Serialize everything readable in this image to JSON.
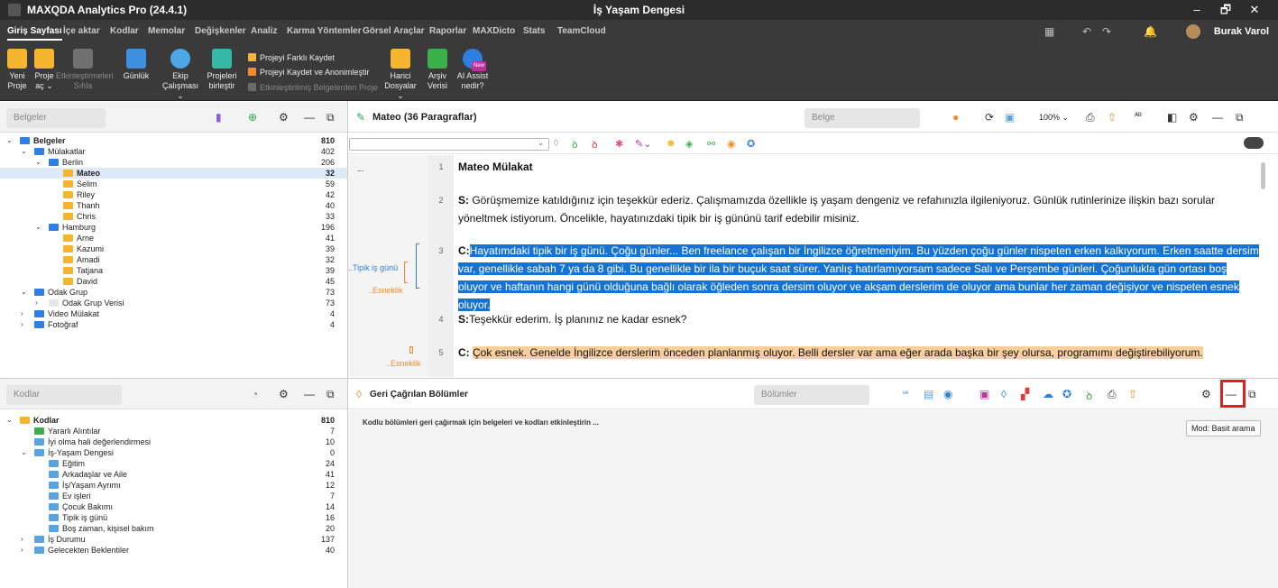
{
  "app": {
    "title": "MAXQDA Analytics Pro (24.4.1)",
    "document_title": "İş Yaşam Dengesi",
    "user": "Burak Varol"
  },
  "window_controls": {
    "minimize": "–",
    "maximize": "🗗",
    "close": "✕"
  },
  "menu": {
    "tabs": [
      "Giriş Sayfası",
      "İçe aktar",
      "Kodlar",
      "Memolar",
      "Değişkenler",
      "Analiz",
      "Karma Yöntemler",
      "Görsel Araçlar",
      "Raporlar",
      "MAXDicto",
      "Stats",
      "TeamCloud"
    ],
    "active_tab": "Giriş Sayfası"
  },
  "ribbon": {
    "new_project": "Yeni\nProje",
    "open_project": "Proje\naç ⌄",
    "activate_memos": "Etkinleştirmeleri\nSıfıla",
    "logbook": "Günlük",
    "teamwork": "Ekip\nÇalışması ⌄",
    "merge_projects": "Projeleri\nbirleştir",
    "save_as": "Projeyi Farklı Kaydet",
    "save_anonymize": "Projeyi Kaydet ve Anonimleştir",
    "save_activated": "Etkinleştirilmiş Belgelerden Proje",
    "external_files": "Harici\nDosyalar ⌄",
    "archive_data": "Arşiv\nVerisi",
    "ai_assist": "AI Assist\nnedir?",
    "ai_badge": "New"
  },
  "documents_panel": {
    "search_placeholder": "Belgeler",
    "rows": [
      {
        "label": "Belgeler",
        "count": "810",
        "level": 0,
        "bold": true,
        "twisty": "⌄"
      },
      {
        "label": "Mülakatlar",
        "count": "402",
        "level": 1,
        "twisty": "⌄"
      },
      {
        "label": "Berlin",
        "count": "206",
        "level": 2,
        "twisty": "⌄"
      },
      {
        "label": "Mateo",
        "count": "32",
        "level": 3,
        "bold": true,
        "selected": true
      },
      {
        "label": "Selim",
        "count": "59",
        "level": 3
      },
      {
        "label": "Riley",
        "count": "42",
        "level": 3
      },
      {
        "label": "Thanh",
        "count": "40",
        "level": 3
      },
      {
        "label": "Chris",
        "count": "33",
        "level": 3
      },
      {
        "label": "Hamburg",
        "count": "196",
        "level": 2,
        "twisty": "⌄"
      },
      {
        "label": "Arne",
        "count": "41",
        "level": 3
      },
      {
        "label": "Kazumi",
        "count": "39",
        "level": 3
      },
      {
        "label": "Amadi",
        "count": "32",
        "level": 3
      },
      {
        "label": "Tatjana",
        "count": "39",
        "level": 3
      },
      {
        "label": "David",
        "count": "45",
        "level": 3
      },
      {
        "label": "Odak Grup",
        "count": "73",
        "level": 1,
        "twisty": "⌄"
      },
      {
        "label": "Odak Grup Verisi",
        "count": "73",
        "level": 2,
        "twisty": "›"
      },
      {
        "label": "Video Mülakat",
        "count": "4",
        "level": 1,
        "twisty": "›"
      },
      {
        "label": "Fotoğraf",
        "count": "4",
        "level": 1,
        "twisty": "›"
      }
    ]
  },
  "codes_panel": {
    "search_placeholder": "Kodlar",
    "rows": [
      {
        "label": "Kodlar",
        "count": "810",
        "level": 0,
        "bold": true,
        "twisty": "⌄"
      },
      {
        "label": "Yararlı Alıntılar",
        "count": "7",
        "level": 1
      },
      {
        "label": "İyi olma hali değerlendirmesi",
        "count": "10",
        "level": 1
      },
      {
        "label": "İş-Yaşam Dengesi",
        "count": "0",
        "level": 1,
        "twisty": "⌄"
      },
      {
        "label": "Eğitim",
        "count": "24",
        "level": 2
      },
      {
        "label": "Arkadaşlar ve Aile",
        "count": "41",
        "level": 2
      },
      {
        "label": "İş/Yaşam Ayrımı",
        "count": "12",
        "level": 2
      },
      {
        "label": "Ev işleri",
        "count": "7",
        "level": 2
      },
      {
        "label": "Çocuk Bakımı",
        "count": "14",
        "level": 2
      },
      {
        "label": "Tipik iş günü",
        "count": "16",
        "level": 2
      },
      {
        "label": "Boş zaman, kişisel bakım",
        "count": "20",
        "level": 2
      },
      {
        "label": "İş Durumu",
        "count": "137",
        "level": 1,
        "twisty": "›"
      },
      {
        "label": "Gelecekten Beklentiler",
        "count": "40",
        "level": 1,
        "twisty": "›"
      }
    ]
  },
  "document_browser": {
    "title": "Mateo  (36 Paragraflar)",
    "search_placeholder": "Belge",
    "zoom": "100% ⌄",
    "more": "...",
    "paragraphs": [
      {
        "num": "1",
        "text": "Mateo Mülakat"
      },
      {
        "num": "2",
        "speaker": "S:",
        "text": " Görüşmemize katıldığınız için teşekkür ederiz. Çalışmamızda özellikle iş yaşam dengeniz ve refahınızla ilgileniyoruz. Günlük rutinlerinize ilişkin bazı sorular yöneltmek istiyorum. Öncelikle, hayatınızdaki tipik bir iş gününü tarif edebilir misiniz."
      },
      {
        "num": "3",
        "speaker": "C:",
        "text": "Hayatımdaki tipik bir iş günü. Çoğu günler... Ben freelance çalışan bir İngilizce öğretmeniyim. Bu yüzden çoğu günler nispeten erken kalkıyorum. Erken saatte dersim var, genellikle sabah 7 ya da 8 gibi. Bu genellikle bir ila bir buçuk saat sürer. Yanlış hatırlamıyorsam sadece Salı ve Perşembe günleri. Çoğunlukla gün ortası boş oluyor ve haftanın hangi günü olduğuna bağlı olarak öğleden sonra dersim oluyor ve akşam derslerim de oluyor ama bunlar her zaman değişiyor ve nispeten esnek oluyor."
      },
      {
        "num": "4",
        "speaker": "S:",
        "text": "Teşekkür ederim. İş planınız ne kadar esnek?"
      },
      {
        "num": "5",
        "speaker": "C:",
        "text": "Çok esnek. Genelde İngilizce derslerim önceden planlanmış oluyor. Belli dersler var ama eğer arada başka bir şey olursa, programımı değiştirebiliyorum."
      }
    ],
    "code_labels": {
      "tipik": "..Tipik iş günü",
      "esneklik1": "..Esneklik",
      "esneklik2": "..Esneklik"
    }
  },
  "retrieved_segments": {
    "title": "Geri Çağrılan Bölümler",
    "search_placeholder": "Bölümler",
    "message": "Kodlu bölümleri geri çağırmak için belgeleri ve kodları etkinleştirin ...",
    "tooltip": "Mod: Basit arama"
  },
  "colors": {
    "accent_blue": "#1673d6",
    "highlight_orange": "#f8cf9a",
    "code_yellow": "#f5c242",
    "code_orange": "#f59b23",
    "code_blue": "#5aa4e0",
    "dark_chrome": "#3a3a3a"
  }
}
